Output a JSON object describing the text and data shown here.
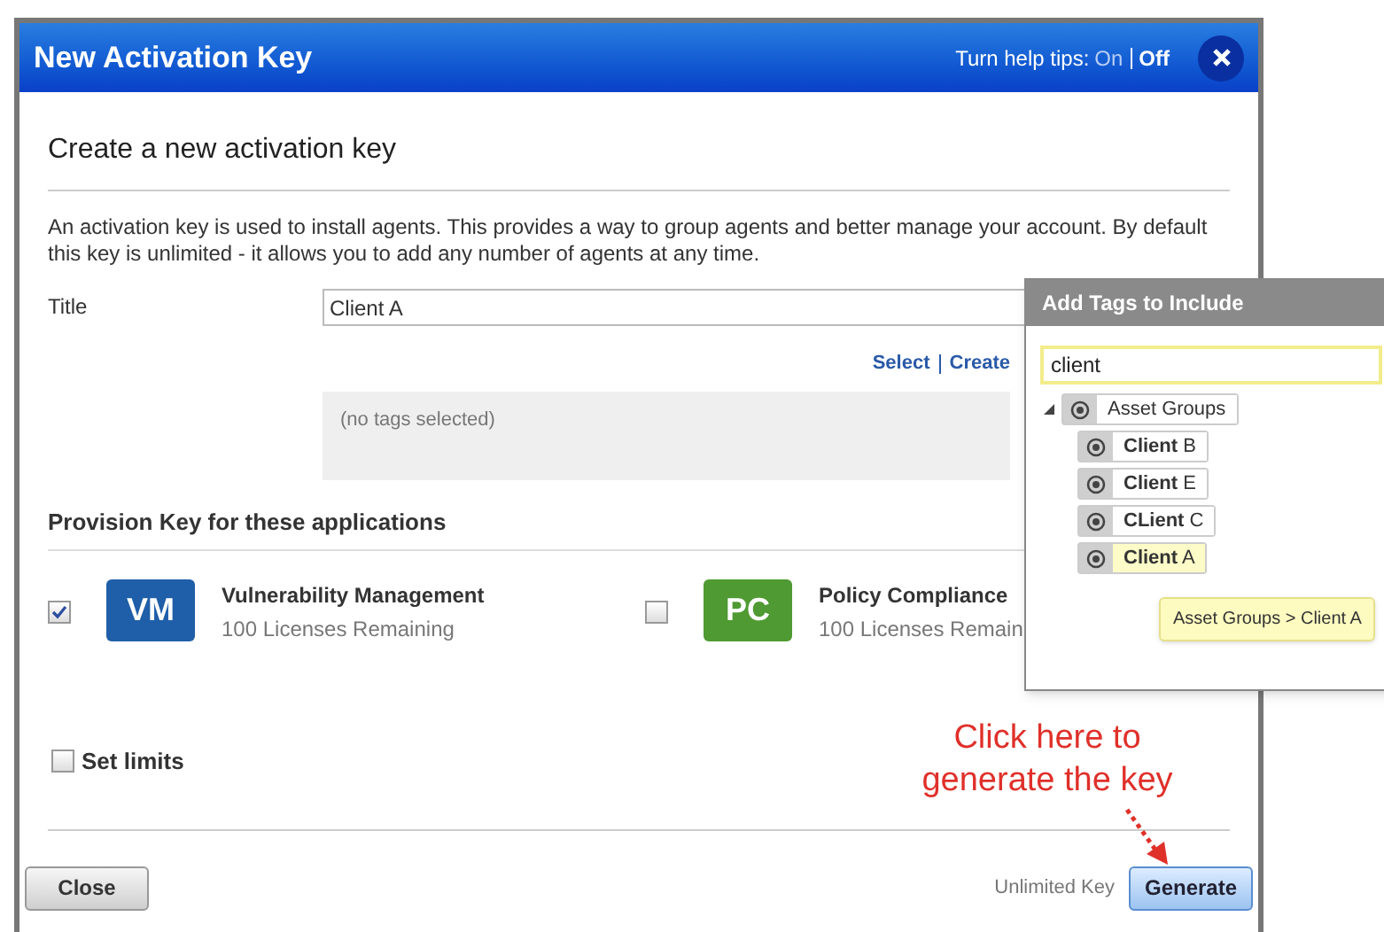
{
  "dialog": {
    "title": "New Activation Key",
    "help_tips": {
      "label": "Turn help tips:",
      "options": [
        {
          "label": "On",
          "selected": false
        },
        {
          "label": "Off",
          "selected": true
        }
      ]
    },
    "heading": "Create a new activation key",
    "description": "An activation key is used to install agents. This provides a way to group agents and better manage your account. By default this key is unlimited - it allows you to add any number of agents at any time.",
    "title_field": {
      "label": "Title",
      "value": "Client A"
    },
    "tag_links": [
      "Select",
      "Create"
    ],
    "tags_placeholder": "(no tags selected)",
    "section_heading": "Provision Key for these applications",
    "applications": [
      {
        "badge": "VM",
        "color": "#1f5ea8",
        "name": "Vulnerability Management",
        "licenses": "100 Licenses Remaining",
        "checked": true
      },
      {
        "badge": "PC",
        "color": "#4f9a32",
        "name": "Policy Compliance",
        "licenses": "100 Licenses Remain",
        "checked": false
      }
    ],
    "set_limits": {
      "label": "Set limits",
      "checked": false
    },
    "buttons": {
      "close": "Close",
      "status": "Unlimited Key",
      "generate": "Generate"
    }
  },
  "tag_popup": {
    "title": "Add Tags to Include",
    "search": {
      "value": "client"
    },
    "tree": [
      {
        "label": "Asset Groups",
        "expanded": true,
        "selected": false,
        "children": [
          {
            "label": "**Client** B",
            "selected": false
          },
          {
            "label": "**Client** E",
            "selected": false
          },
          {
            "label": "**CLient** C",
            "selected": false
          },
          {
            "label": "**Client** A",
            "selected": true
          }
        ]
      }
    ],
    "tooltip": "Asset Groups > Client A"
  },
  "annotation": {
    "lines": [
      "Click here to",
      "generate the key"
    ]
  }
}
